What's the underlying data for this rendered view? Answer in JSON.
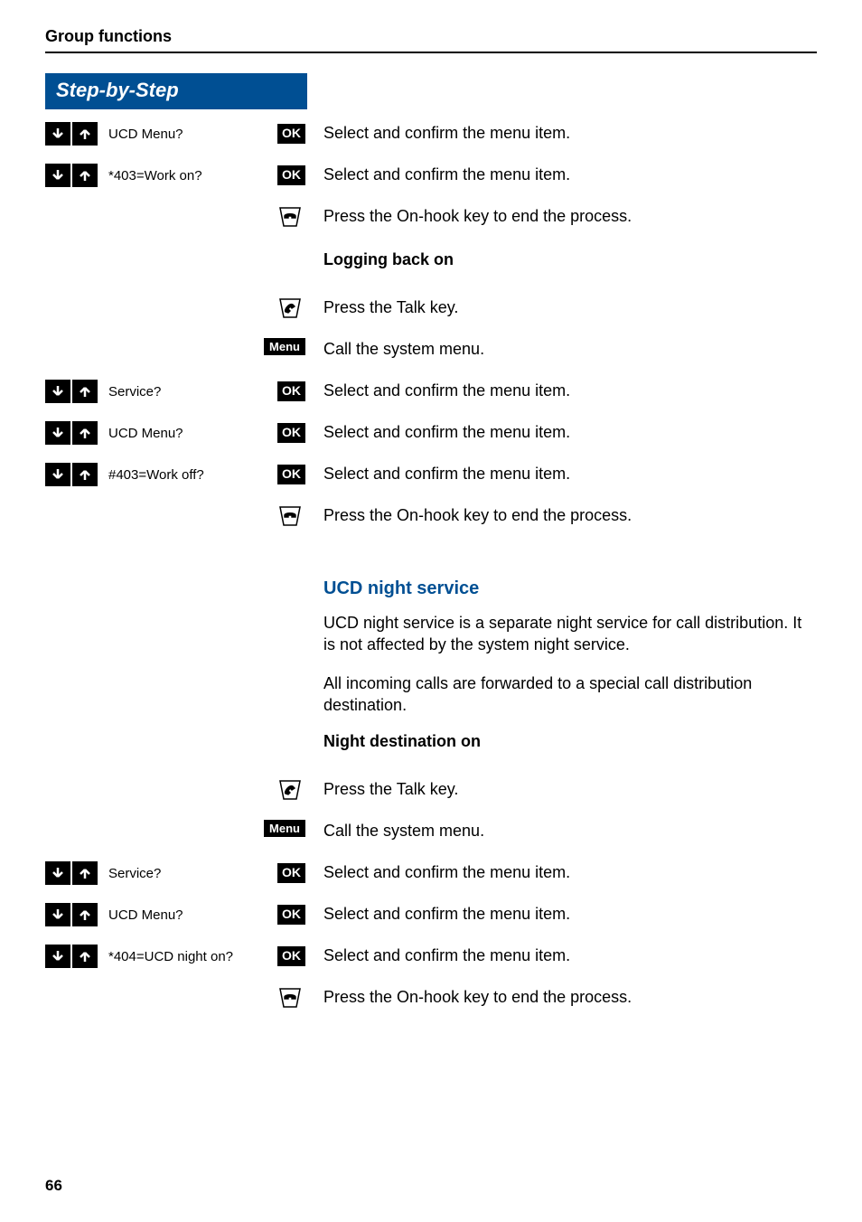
{
  "header": {
    "title": "Group functions"
  },
  "banner": {
    "title": "Step-by-Step"
  },
  "labels": {
    "ok": "OK",
    "menu": "Menu"
  },
  "rows": [
    {
      "left": {
        "type": "disp_ok",
        "disp": "UCD Menu?"
      },
      "right": "Select and confirm the menu item."
    },
    {
      "left": {
        "type": "disp_ok",
        "disp": "*403=Work on?"
      },
      "right": "Select and confirm the menu item."
    },
    {
      "left": {
        "type": "onhook"
      },
      "right": "Press the On-hook key to end the process."
    },
    {
      "left": {
        "type": "none"
      },
      "right_bold": "Logging back on"
    },
    {
      "left": {
        "type": "talk"
      },
      "right": "Press the Talk key."
    },
    {
      "left": {
        "type": "menu"
      },
      "right": "Call the system menu."
    },
    {
      "left": {
        "type": "disp_ok",
        "disp": "Service?"
      },
      "right": "Select and confirm the menu item."
    },
    {
      "left": {
        "type": "disp_ok",
        "disp": "UCD Menu?"
      },
      "right": "Select and confirm the menu item."
    },
    {
      "left": {
        "type": "disp_ok",
        "disp": "#403=Work off?"
      },
      "right": "Select and confirm the menu item."
    },
    {
      "left": {
        "type": "onhook"
      },
      "right": "Press the On-hook key to end the process."
    }
  ],
  "section2": {
    "heading": "UCD night service",
    "para1": "UCD night service is a separate night service for call distribution. It is not affected by the system night service.",
    "para2": "All incoming calls are forwarded to a special call distribution destination.",
    "subbold": "Night destination on"
  },
  "rows2": [
    {
      "left": {
        "type": "talk"
      },
      "right": "Press the Talk key."
    },
    {
      "left": {
        "type": "menu"
      },
      "right": "Call the system menu."
    },
    {
      "left": {
        "type": "disp_ok",
        "disp": "Service?"
      },
      "right": "Select and confirm the menu item."
    },
    {
      "left": {
        "type": "disp_ok",
        "disp": "UCD Menu?"
      },
      "right": "Select and confirm the menu item."
    },
    {
      "left": {
        "type": "disp_ok",
        "disp": "*404=UCD night on?"
      },
      "right": "Select and confirm the menu item."
    },
    {
      "left": {
        "type": "onhook"
      },
      "right": "Press the On-hook key to end the process."
    }
  ],
  "page_number": "66"
}
